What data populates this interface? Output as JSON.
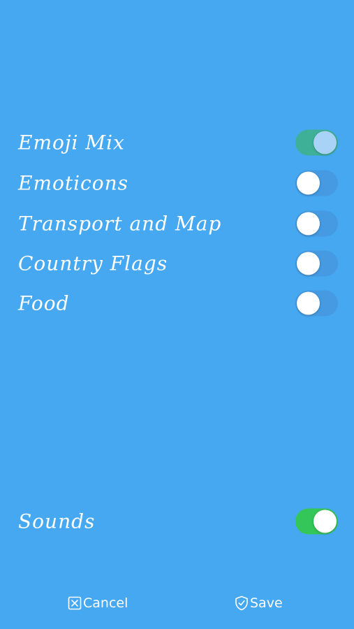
{
  "categories": [
    {
      "label": "Emoji Mix",
      "enabled": true
    },
    {
      "label": "Emoticons",
      "enabled": false
    },
    {
      "label": "Transport and Map",
      "enabled": false
    },
    {
      "label": "Country Flags",
      "enabled": false
    },
    {
      "label": "Food",
      "enabled": false
    }
  ],
  "sounds": {
    "label": "Sounds",
    "enabled": true
  },
  "actions": {
    "cancel_label": "Cancel",
    "cancel_icon": "close-box-icon",
    "save_label": "Save",
    "save_icon": "shield-check-icon"
  },
  "colors": {
    "background": "#45a8f0",
    "toggle_on_teal": "#3fb098",
    "toggle_on_green": "#35c659",
    "text": "#ffffff"
  }
}
